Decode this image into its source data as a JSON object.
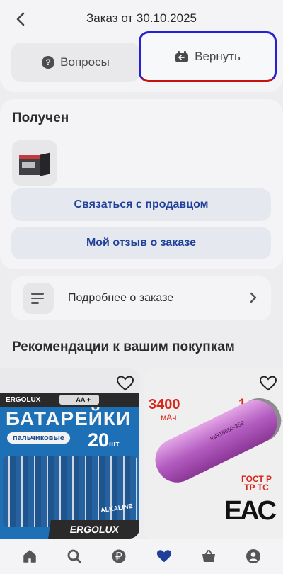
{
  "header": {
    "title": "Заказ от 30.10.2025",
    "back_icon": "chevron-left-icon"
  },
  "actions": {
    "questions_label": "Вопросы",
    "questions_icon": "question-circle-icon",
    "return_label": "Вернуть",
    "return_icon": "return-box-icon"
  },
  "order": {
    "status": "Получен",
    "contact_seller_label": "Связаться с продавцом",
    "my_review_label": "Мой отзыв о заказе"
  },
  "details": {
    "label": "Подробнее о заказе",
    "icon": "list-icon"
  },
  "recommendations": {
    "title": "Рекомендации к вашим покупкам",
    "items": [
      {
        "brand": "ERGOLUX",
        "size": "— АА +",
        "headline": "БАТАРЕЙКИ",
        "subtitle": "пальчиковые",
        "count": "20",
        "count_unit": "шт",
        "type_label": "ALKALINE",
        "bottom_brand": "ERGOLUX"
      },
      {
        "capacity": "3400",
        "capacity_unit": "мАч",
        "quantity": "1 шт",
        "cell_print": "INR18650-35E",
        "cert_line1": "ГОСТ Р",
        "cert_line2": "ТР ТС",
        "cert_mark": "EAC"
      }
    ]
  },
  "tabbar": {
    "items": [
      "home-icon",
      "search-icon",
      "ruble-coin-icon",
      "heart-icon",
      "cart-icon",
      "profile-icon"
    ],
    "active": "heart-icon"
  },
  "colors": {
    "accent_blue": "#1f3f9a",
    "highlight_border_blue": "#2620d6",
    "highlight_border_red": "#c81010",
    "promo_red": "#d9251c"
  }
}
